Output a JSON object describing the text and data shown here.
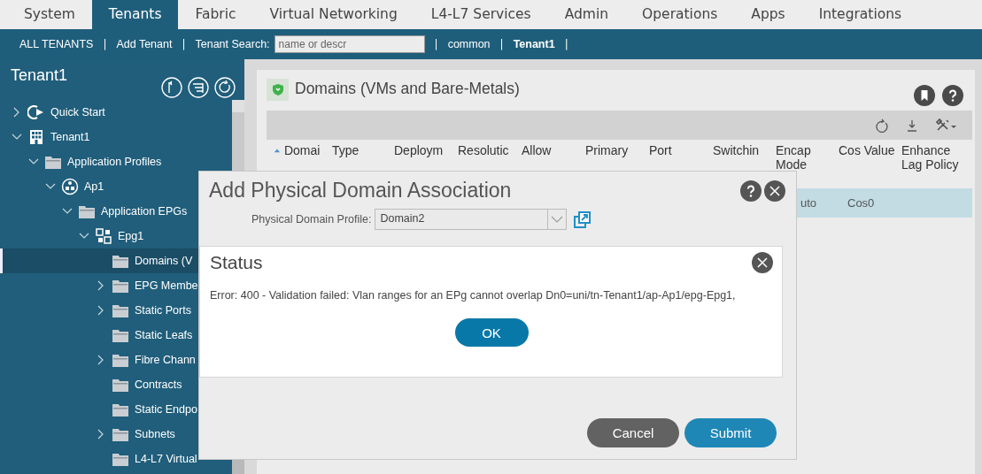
{
  "top_tabs": [
    {
      "label": "System",
      "selected": false
    },
    {
      "label": "Tenants",
      "selected": true
    },
    {
      "label": "Fabric",
      "selected": false
    },
    {
      "label": "Virtual Networking",
      "selected": false
    },
    {
      "label": "L4-L7 Services",
      "selected": false
    },
    {
      "label": "Admin",
      "selected": false
    },
    {
      "label": "Operations",
      "selected": false
    },
    {
      "label": "Apps",
      "selected": false
    },
    {
      "label": "Integrations",
      "selected": false
    }
  ],
  "tenant_bar": [
    {
      "kind": "link",
      "label": "ALL TENANTS",
      "selected": false
    },
    {
      "kind": "separator",
      "label": "|"
    },
    {
      "kind": "link",
      "label": "Add Tenant",
      "selected": false
    },
    {
      "kind": "separator",
      "label": "|"
    },
    {
      "kind": "search",
      "label": "Tenant Search:",
      "placeholder": "name or descr"
    },
    {
      "kind": "separator",
      "label": "|"
    },
    {
      "kind": "link",
      "label": "common",
      "selected": false
    },
    {
      "kind": "separator",
      "label": "|"
    },
    {
      "kind": "link",
      "label": "Tenant1",
      "selected": true
    },
    {
      "kind": "separator",
      "label": "|"
    }
  ],
  "sidebar": {
    "title": "Tenant1",
    "tree": [
      {
        "label": "Quick Start",
        "kind": "start",
        "expanded": false,
        "selected": false
      },
      {
        "label": "Tenant1",
        "kind": "tenant",
        "expanded": true,
        "selected": false,
        "children": [
          {
            "label": "Application Profiles",
            "kind": "folder",
            "expanded": true,
            "selected": false,
            "children": [
              {
                "label": "Ap1",
                "kind": "app",
                "expanded": true,
                "selected": false,
                "children": [
                  {
                    "label": "Application EPGs",
                    "kind": "folder",
                    "expanded": true,
                    "selected": false,
                    "children": [
                      {
                        "label": "Epg1",
                        "kind": "epg",
                        "expanded": true,
                        "selected": false,
                        "children": [
                          {
                            "label": "Domains (V",
                            "kind": "folder",
                            "selected": true
                          },
                          {
                            "label": "EPG Membe",
                            "kind": "folder",
                            "expanded": false,
                            "selected": false
                          },
                          {
                            "label": "Static Ports",
                            "kind": "folder",
                            "expanded": false,
                            "selected": false
                          },
                          {
                            "label": "Static Leafs",
                            "kind": "folder",
                            "selected": false
                          },
                          {
                            "label": "Fibre Chann",
                            "kind": "folder",
                            "expanded": false,
                            "selected": false
                          },
                          {
                            "label": "Contracts",
                            "kind": "folder",
                            "selected": false
                          },
                          {
                            "label": "Static Endpo",
                            "kind": "folder",
                            "selected": false
                          },
                          {
                            "label": "Subnets",
                            "kind": "folder",
                            "expanded": false,
                            "selected": false
                          },
                          {
                            "label": "L4-L7 Virtual",
                            "kind": "folder",
                            "selected": false
                          }
                        ]
                      }
                    ]
                  }
                ]
              }
            ]
          }
        ]
      }
    ]
  },
  "panel": {
    "title": "Domains (VMs and Bare-Metals)",
    "columns": [
      {
        "label": "Domai",
        "sorted": true
      },
      {
        "label": "Type",
        "sorted": false
      },
      {
        "label": "Deploym",
        "sorted": false
      },
      {
        "label": "Resolutic",
        "sorted": false
      },
      {
        "label": "Allow",
        "sorted": false
      },
      {
        "label": "Primary",
        "sorted": false
      },
      {
        "label": "Port",
        "sorted": false
      },
      {
        "label": "Switchin",
        "sorted": false
      },
      {
        "label": "Encap Mode",
        "sorted": false
      },
      {
        "label": "Cos Value",
        "sorted": false
      },
      {
        "label": "Enhance Lag Policy",
        "sorted": false
      }
    ],
    "rows": [
      {
        "selected": true,
        "cells": {
          "8": "uto",
          "9": "Cos0"
        }
      }
    ]
  },
  "dialog": {
    "title": "Add Physical Domain Association",
    "field_label": "Physical Domain Profile:",
    "field_value": "Domain2",
    "status": {
      "title": "Status",
      "message": "Error: 400 - Validation failed: Vlan ranges for an EPg cannot overlap Dn0=uni/tn-Tenant1/ap-Ap1/epg-Epg1,",
      "button": "OK"
    },
    "buttons": [
      {
        "label": "Cancel",
        "kind": "secondary"
      },
      {
        "label": "Submit",
        "kind": "primary"
      }
    ]
  }
}
